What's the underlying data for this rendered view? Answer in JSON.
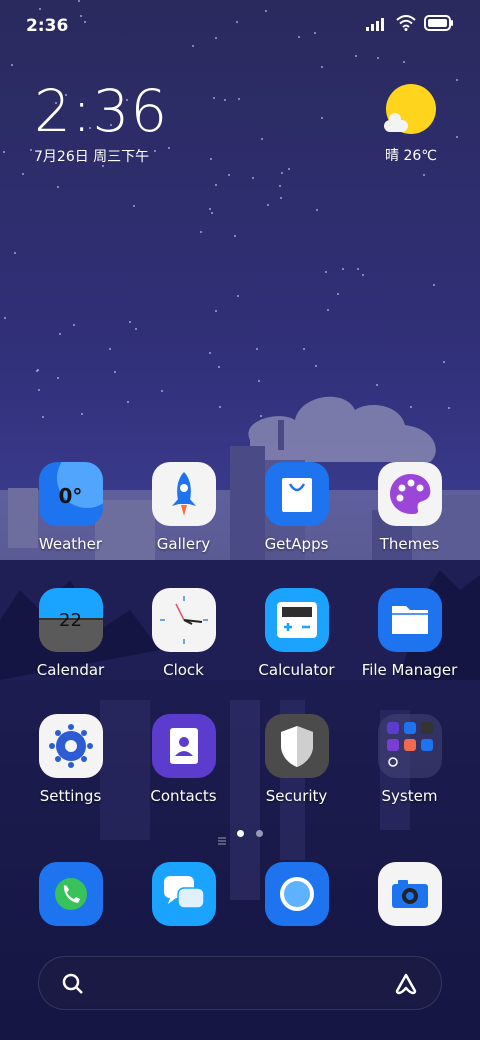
{
  "status_bar": {
    "time": "2:36",
    "icons": [
      "signal-icon",
      "wifi-icon",
      "battery-icon"
    ]
  },
  "clock_widget": {
    "time": "2:36",
    "date": "7月26日 周三下午"
  },
  "weather_widget": {
    "icon": "sun-cloud-icon",
    "text": "晴 26℃"
  },
  "apps": [
    {
      "label": "Weather",
      "icon": "weather-icon",
      "tile_text": "0°"
    },
    {
      "label": "Gallery",
      "icon": "rocket-icon"
    },
    {
      "label": "GetApps",
      "icon": "shopping-bag-icon"
    },
    {
      "label": "Themes",
      "icon": "palette-icon"
    },
    {
      "label": "Calendar",
      "icon": "calendar-icon",
      "tile_text": "22"
    },
    {
      "label": "Clock",
      "icon": "clock-icon"
    },
    {
      "label": "Calculator",
      "icon": "calculator-icon"
    },
    {
      "label": "File Manager",
      "icon": "folder-icon"
    },
    {
      "label": "Settings",
      "icon": "gear-icon"
    },
    {
      "label": "Contacts",
      "icon": "contacts-book-icon"
    },
    {
      "label": "Security",
      "icon": "shield-icon"
    },
    {
      "label": "System",
      "icon": "folder-grid-icon"
    }
  ],
  "page_indicator": {
    "pages": 2,
    "active": 1
  },
  "dock": [
    {
      "app": "Phone",
      "icon": "phone-icon"
    },
    {
      "app": "Messages",
      "icon": "chat-bubbles-icon"
    },
    {
      "app": "Browser",
      "icon": "browser-icon"
    },
    {
      "app": "Camera",
      "icon": "camera-icon"
    }
  ],
  "search_bar": {
    "left_icon": "search-icon",
    "right_icon": "assistant-icon"
  },
  "colors": {
    "sky_top": "#2a2a5e",
    "sky_mid": "#3a3a8c",
    "sun": "#ffd41c",
    "tile_blue": "#1e74ef",
    "tile_white": "#f4f4f4"
  }
}
